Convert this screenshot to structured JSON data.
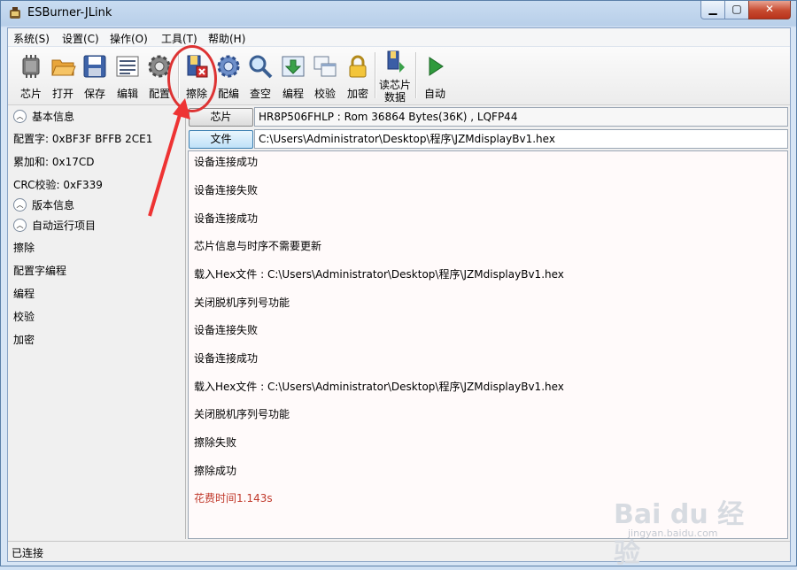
{
  "window": {
    "title": "ESBurner-JLink"
  },
  "menu": [
    "系统(S)",
    "设置(C)",
    "操作(O)",
    "工具(T)",
    "帮助(H)"
  ],
  "toolbar": {
    "buttons": [
      {
        "label": "芯片",
        "icon": "chip-icon"
      },
      {
        "label": "打开",
        "icon": "folder-open-icon"
      },
      {
        "label": "保存",
        "icon": "save-disk-icon"
      },
      {
        "label": "编辑",
        "icon": "edit-list-icon"
      },
      {
        "label": "配置",
        "icon": "gear-config-icon"
      },
      {
        "label": "擦除",
        "icon": "erase-icon"
      },
      {
        "label": "配编",
        "icon": "gear-blue-icon"
      },
      {
        "label": "查空",
        "icon": "magnifier-icon"
      },
      {
        "label": "编程",
        "icon": "download-arrow-icon"
      },
      {
        "label": "校验",
        "icon": "verify-windows-icon"
      },
      {
        "label": "加密",
        "icon": "padlock-icon"
      },
      {
        "label": "读芯片",
        "label2": "数据",
        "icon": "read-chip-icon"
      },
      {
        "label": "自动",
        "icon": "play-arrow-icon"
      }
    ]
  },
  "left_panel": {
    "basic_info_header": "基本信息",
    "config_word": "配置字: 0xBF3F BFFB 2CE1",
    "checksum": "累加和: 0x17CD",
    "crc": "CRC校验: 0xF339",
    "version_header": "版本信息",
    "auto_header": "自动运行项目",
    "auto_items": [
      "擦除",
      "配置字编程",
      "编程",
      "校验",
      "加密"
    ]
  },
  "right_panel": {
    "chip_button": "芯片",
    "chip_value": "HR8P506FHLP : Rom 36864 Bytes(36K) , LQFP44",
    "file_button": "文件",
    "file_value": "C:\\Users\\Administrator\\Desktop\\程序\\JZMdisplayBv1.hex"
  },
  "log": [
    "设备连接成功",
    "设备连接失败",
    "设备连接成功",
    "芯片信息与时序不需要更新",
    "载入Hex文件 : C:\\Users\\Administrator\\Desktop\\程序\\JZMdisplayBv1.hex",
    "关闭脱机序列号功能",
    "设备连接失败",
    "设备连接成功",
    "载入Hex文件 : C:\\Users\\Administrator\\Desktop\\程序\\JZMdisplayBv1.hex",
    "关闭脱机序列号功能",
    "擦除失败",
    "擦除成功",
    "花费时间1.143s"
  ],
  "colors": {
    "log_time_color": "#c0392b",
    "annotation": "#dd3333"
  },
  "status": {
    "text": "已连接"
  },
  "watermark": {
    "text": "Bai du 经验",
    "sub": "jingyan.baidu.com"
  }
}
